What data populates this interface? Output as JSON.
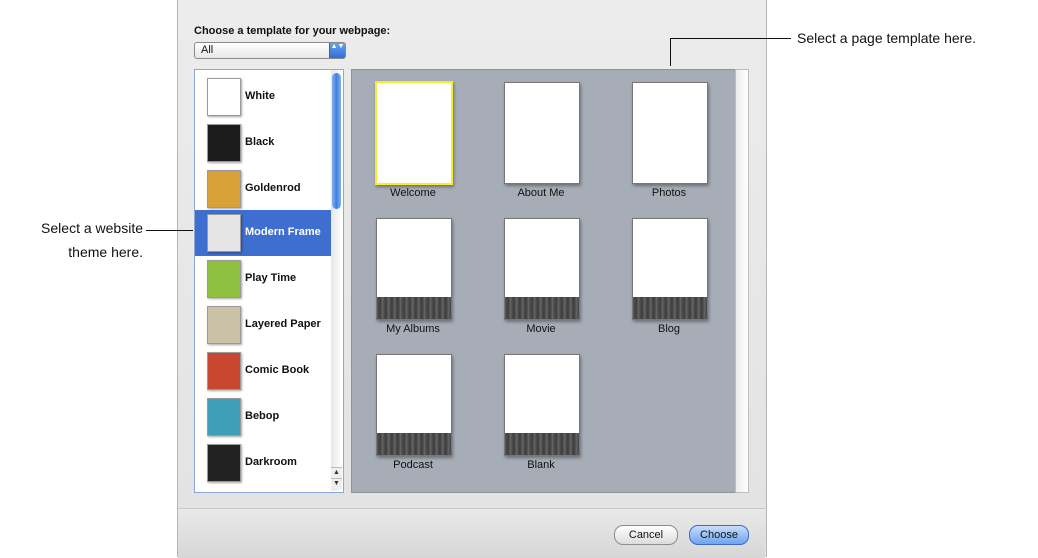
{
  "dialog": {
    "prompt": "Choose a template for your webpage:",
    "category_popup": {
      "value": "All",
      "arrows": "▲▼"
    },
    "themes": [
      {
        "label": "White",
        "selected": false,
        "accent": "#c9d4dc"
      },
      {
        "label": "Black",
        "selected": false,
        "accent": "#1b1b1b"
      },
      {
        "label": "Goldenrod",
        "selected": false,
        "accent": "#d8a13a"
      },
      {
        "label": "Modern Frame",
        "selected": true,
        "accent": "#8d8d8d"
      },
      {
        "label": "Play Time",
        "selected": false,
        "accent": "#8fbf3e"
      },
      {
        "label": "Layered Paper",
        "selected": false,
        "accent": "#c9c2a6"
      },
      {
        "label": "Comic Book",
        "selected": false,
        "accent": "#c9472f"
      },
      {
        "label": "Bebop",
        "selected": false,
        "accent": "#3da0b8"
      },
      {
        "label": "Darkroom",
        "selected": false,
        "accent": "#222222"
      }
    ],
    "scroll_arrows": {
      "up": "▲",
      "down": "▼"
    },
    "pages": [
      {
        "label": "Welcome",
        "selected": true
      },
      {
        "label": "About Me",
        "selected": false
      },
      {
        "label": "Photos",
        "selected": false
      },
      {
        "label": "My Albums",
        "selected": false
      },
      {
        "label": "Movie",
        "selected": false
      },
      {
        "label": "Blog",
        "selected": false
      },
      {
        "label": "Podcast",
        "selected": false
      },
      {
        "label": "Blank",
        "selected": false
      }
    ],
    "buttons": {
      "cancel": "Cancel",
      "choose": "Choose"
    }
  },
  "callouts": {
    "page_template": "Select a page template here.",
    "theme_line1": "Select a website",
    "theme_line2": "theme here."
  },
  "colors": {
    "selection": "#3e6ed0",
    "page_pane": "#a7adb6",
    "page_selected": "#f6ee2a"
  }
}
